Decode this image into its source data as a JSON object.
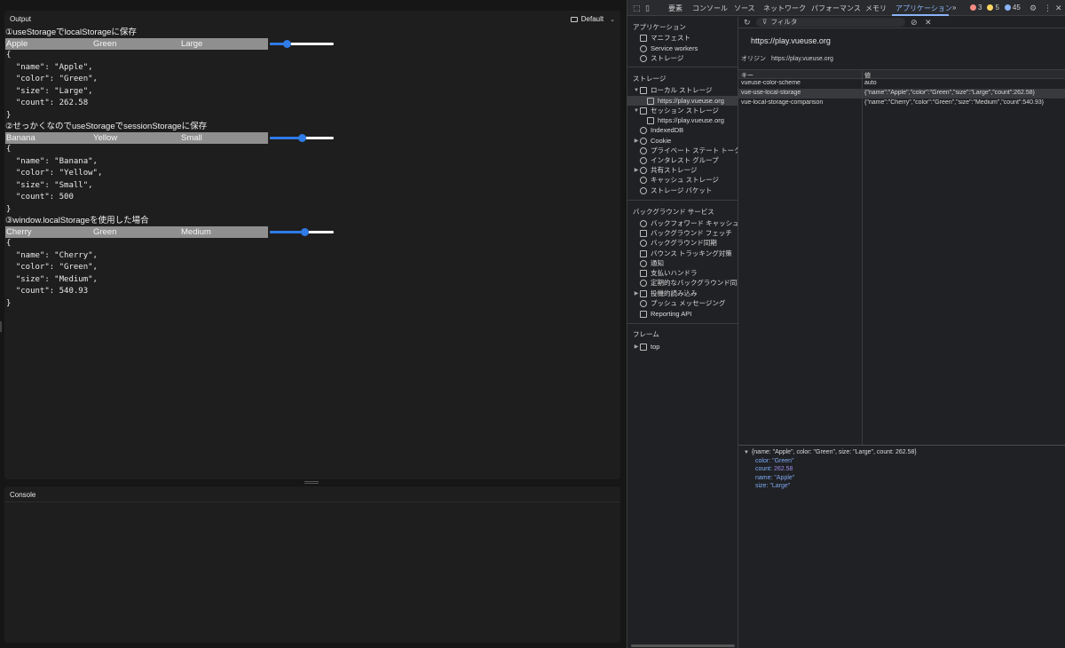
{
  "output": {
    "title": "Output",
    "device_label": "Default",
    "sections": [
      {
        "title": "①useStorageでlocalStorageに保存",
        "cells": [
          "Apple",
          "Green",
          "Large"
        ],
        "slider_fraction": 0.27,
        "json_lines": [
          "{",
          "  \"name\": \"Apple\",",
          "  \"color\": \"Green\",",
          "  \"size\": \"Large\",",
          "  \"count\": 262.58",
          "}"
        ]
      },
      {
        "title": "②せっかくなのでuseStorageでsessionStorageに保存",
        "cells": [
          "Banana",
          "Yellow",
          "Small"
        ],
        "slider_fraction": 0.5,
        "json_lines": [
          "{",
          "  \"name\": \"Banana\",",
          "  \"color\": \"Yellow\",",
          "  \"size\": \"Small\",",
          "  \"count\": 500",
          "}"
        ]
      },
      {
        "title": "③window.localStorageを使用した場合",
        "cells": [
          "Cherry",
          "Green",
          "Medium"
        ],
        "slider_fraction": 0.54,
        "json_lines": [
          "{",
          "  \"name\": \"Cherry\",",
          "  \"color\": \"Green\",",
          "  \"size\": \"Medium\",",
          "  \"count\": 540.93",
          "}"
        ]
      }
    ]
  },
  "console": {
    "title": "Console"
  },
  "devtools": {
    "tabs": [
      "要素",
      "コンソール",
      "ソース",
      "ネットワーク",
      "パフォーマンス",
      "メモリ",
      "アプリケーション"
    ],
    "active_tab": "アプリケーション",
    "more": "»",
    "errors": "3",
    "warnings": "5",
    "messages": "45",
    "colors": {
      "error": "#f28b82",
      "warning": "#fdd663",
      "message": "#8ab4f8",
      "accent": "#8ab4f8"
    },
    "sidebar": {
      "app_header": "アプリケーション",
      "app_items": [
        "マニフェスト",
        "Service workers",
        "ストレージ"
      ],
      "storage_header": "ストレージ",
      "local_storage": "ローカル ストレージ",
      "local_origin": "https://play.vueuse.org",
      "session_storage": "セッション ストレージ",
      "session_origin": "https://play.vueuse.org",
      "storage_items": [
        "IndexedDB",
        "Cookie",
        "プライベート ステート トークン",
        "インタレスト グループ",
        "共有ストレージ",
        "キャッシュ ストレージ",
        "ストレージ バケット"
      ],
      "bg_header": "バックグラウンド サービス",
      "bg_items": [
        "バックフォワード キャッシュ",
        "バックグラウンド フェッチ",
        "バックグラウンド同期",
        "バウンス トラッキング対策",
        "通知",
        "支払いハンドラ",
        "定期的なバックグラウンド同期",
        "投機的読み込み",
        "プッシュ メッセージング",
        "Reporting API"
      ],
      "frames_header": "フレーム",
      "frame_top": "top"
    },
    "main": {
      "filter_placeholder": "フィルタ",
      "origin_title": "https://play.vueuse.org",
      "origin_label": "オリジン",
      "origin_value": "https://play.vueuse.org",
      "col_key": "キー",
      "col_value": "値",
      "rows": [
        {
          "key": "vueuse-color-scheme",
          "value": "auto"
        },
        {
          "key": "vue-use-local-storage",
          "value": "{\"name\":\"Apple\",\"color\":\"Green\",\"size\":\"Large\",\"count\":262.58}"
        },
        {
          "key": "vue-local-storage-comparison",
          "value": "{\"name\":\"Cherry\",\"color\":\"Green\",\"size\":\"Medium\",\"count\":540.93}"
        }
      ],
      "preview_summary": "{name: \"Apple\", color: \"Green\", size: \"Large\", count: 262.58}",
      "preview_props": [
        {
          "key": "color",
          "value": "\"Green\"",
          "kind": "string"
        },
        {
          "key": "count",
          "value": "262.58",
          "kind": "number"
        },
        {
          "key": "name",
          "value": "\"Apple\"",
          "kind": "string"
        },
        {
          "key": "size",
          "value": "\"Large\"",
          "kind": "string"
        }
      ]
    }
  }
}
